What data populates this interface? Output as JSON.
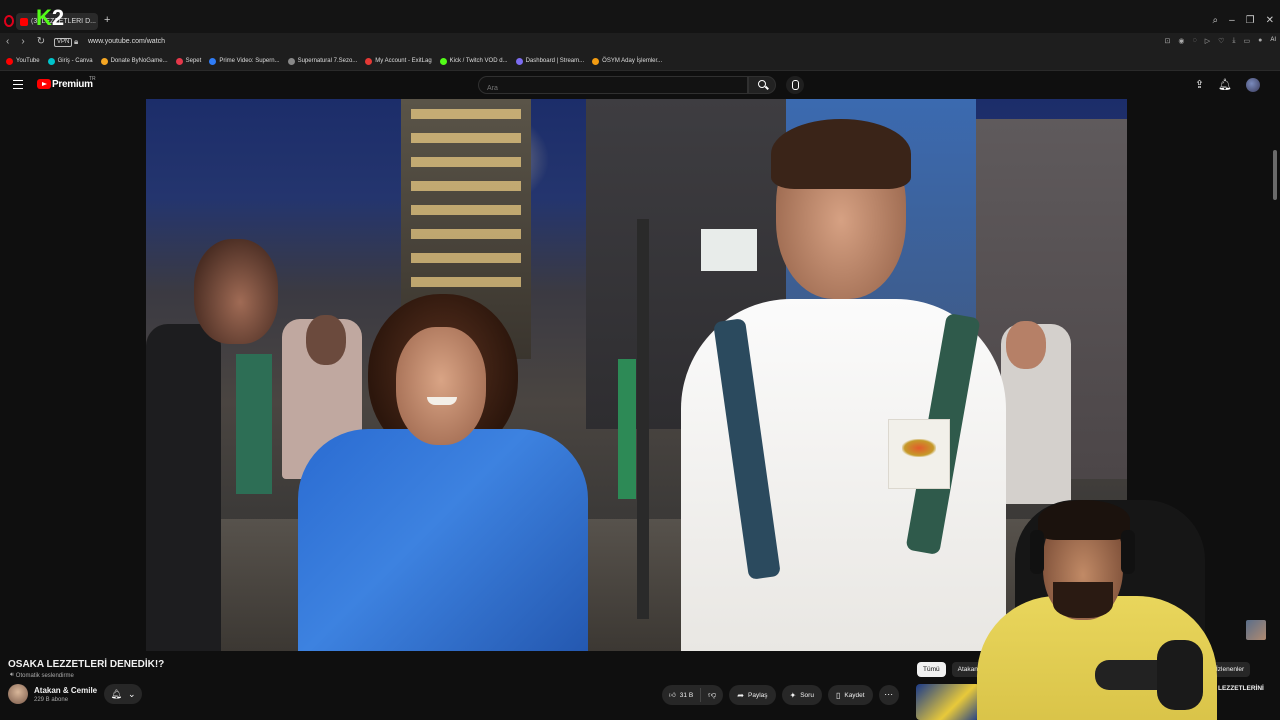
{
  "browser": {
    "tab_title": "(3) LEZZETLERİ D...",
    "overlay_logo": {
      "k": "K",
      "two": "2"
    },
    "url": "www.youtube.com/watch",
    "vpn_label": "VPN",
    "ai_label": "AI",
    "bookmarks": [
      {
        "label": "YouTube",
        "color": "#ff0000"
      },
      {
        "label": "Giriş - Canva",
        "color": "#00c4cc"
      },
      {
        "label": "Donate ByNoGame...",
        "color": "#f5a623"
      },
      {
        "label": "Sepet",
        "color": "#e5384a"
      },
      {
        "label": "Prime Video: Supern...",
        "color": "#2f7cf6"
      },
      {
        "label": "Supernatural 7.Sezo...",
        "color": "#888888"
      },
      {
        "label": "My Account - ExitLag",
        "color": "#e53935"
      },
      {
        "label": "Kick / Twitch VOD d...",
        "color": "#53fc18"
      },
      {
        "label": "Dashboard | Stream...",
        "color": "#7c6cf0"
      },
      {
        "label": "ÖSYM Aday İşlemler...",
        "color": "#f39c12"
      }
    ]
  },
  "youtube": {
    "logo_text": "Premium",
    "region": "TR",
    "search_placeholder": "Ara",
    "video": {
      "title": "OSAKA LEZZETLERİ DENEDİK!?",
      "auto_dub": "Otomatik seslendirme",
      "channel_name": "Atakan & Cemile",
      "subscribers": "229 B abone",
      "likes": "31 B",
      "share_label": "Paylaş",
      "ask_label": "Soru",
      "save_label": "Kaydet"
    },
    "chips": [
      "Tümü",
      "Atakan & Cemile"
    ],
    "chip_right": "İzlenenler",
    "recommendation_title": "LEZZETLERİNİ"
  }
}
